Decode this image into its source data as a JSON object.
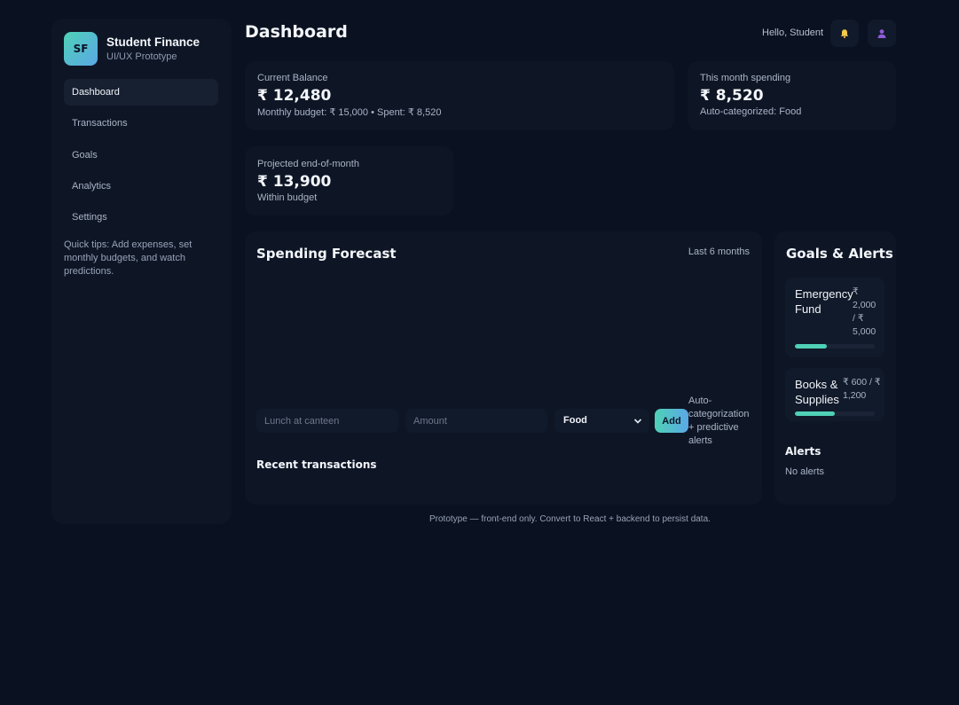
{
  "brand": {
    "logo_text": "SF",
    "title": "Student Finance",
    "subtitle": "UI/UX Prototype"
  },
  "sidebar": {
    "items": [
      {
        "label": "Dashboard",
        "active": true
      },
      {
        "label": "Transactions",
        "active": false
      },
      {
        "label": "Goals",
        "active": false
      },
      {
        "label": "Analytics",
        "active": false
      },
      {
        "label": "Settings",
        "active": false
      }
    ],
    "tips": "Quick tips: Add expenses, set monthly budgets, and watch predictions."
  },
  "header": {
    "title": "Dashboard",
    "greeting": "Hello, Student",
    "notification_icon": "bell-icon",
    "profile_icon": "user-icon"
  },
  "stats": {
    "balance": {
      "label": "Current Balance",
      "value": "₹ 12,480",
      "sub": "Monthly budget: ₹ 15,000 • Spent: ₹ 8,520"
    },
    "month_spending": {
      "label": "This month spending",
      "value": "₹ 8,520",
      "sub": "Auto-categorized: Food"
    },
    "projected": {
      "label": "Projected end-of-month",
      "value": "₹ 13,900",
      "sub": "Within budget"
    }
  },
  "forecast": {
    "title": "Spending Forecast",
    "range": "Last 6 months",
    "form": {
      "description_placeholder": "Lunch at canteen",
      "amount_placeholder": "Amount",
      "category_selected": "Food",
      "add_label": "Add",
      "note": "Auto-categorization + predictive alerts"
    },
    "recent_title": "Recent transactions"
  },
  "goals": {
    "title": "Goals & Alerts",
    "items": [
      {
        "name": "Emergency Fund",
        "amount": "₹ 2,000 / ₹ 5,000",
        "progress": 0.4
      },
      {
        "name": "Books & Supplies",
        "amount": "₹ 600 / ₹ 1,200",
        "progress": 0.5
      }
    ],
    "alerts_title": "Alerts",
    "alerts_empty": "No alerts"
  },
  "colors": {
    "background": "#0a1120",
    "card": "#0e1626",
    "accent": "#4fd1b6",
    "accent_2": "#5aa8e6"
  },
  "footer": "Prototype — front-end only. Convert to React + backend to persist data."
}
